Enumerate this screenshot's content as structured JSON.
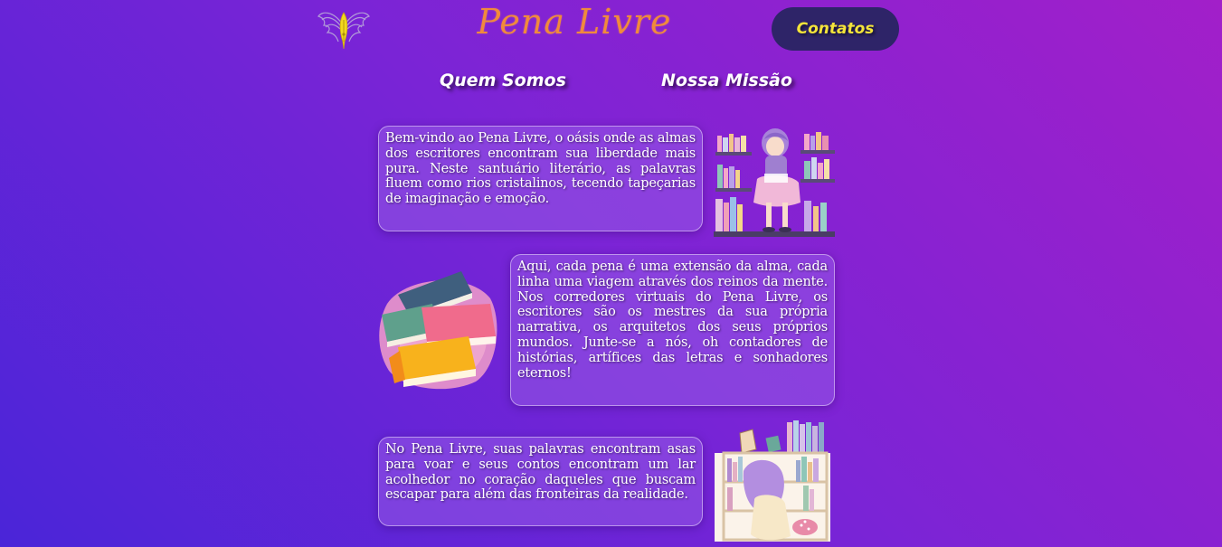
{
  "header": {
    "brand": "Pena Livre",
    "contact_label": "Contatos",
    "logo_icon": "winged-pen-icon"
  },
  "nav": {
    "items": [
      {
        "label": "Quem Somos"
      },
      {
        "label": "Nossa Missão"
      }
    ]
  },
  "sections": [
    {
      "text": "Bem-vindo ao Pena Livre, o oásis onde as almas dos escritores encontram sua liberdade mais pura. Neste santuário literário, as palavras fluem como rios cristalinos, tecendo tapeçarias de imaginação e emoção.",
      "image_icon": "girl-reading-bookshelf-illustration"
    },
    {
      "text": "Aqui, cada pena é uma extensão da alma, cada linha uma viagem através dos reinos da mente. Nos corredores virtuais do Pena Livre, os escritores são os mestres da sua própria narrativa, os arquitetos dos seus próprios mundos. Junte-se a nós, oh contadores de histórias, artífices das letras e sonhadores eternos!",
      "image_icon": "stack-of-books-illustration"
    },
    {
      "text": "No Pena Livre, suas palavras encontram asas para voar e seus contos encontram um lar acolhedor no coração daqueles que buscam escapar para além das fronteiras da realidade.",
      "image_icon": "girl-at-bookshelf-illustration"
    }
  ],
  "colors": {
    "background_start": "#4a25d8",
    "background_end": "#a21fc9",
    "brand": "#f08a3c",
    "contact_bg": "#2e2468",
    "contact_text": "#f4e43a"
  }
}
